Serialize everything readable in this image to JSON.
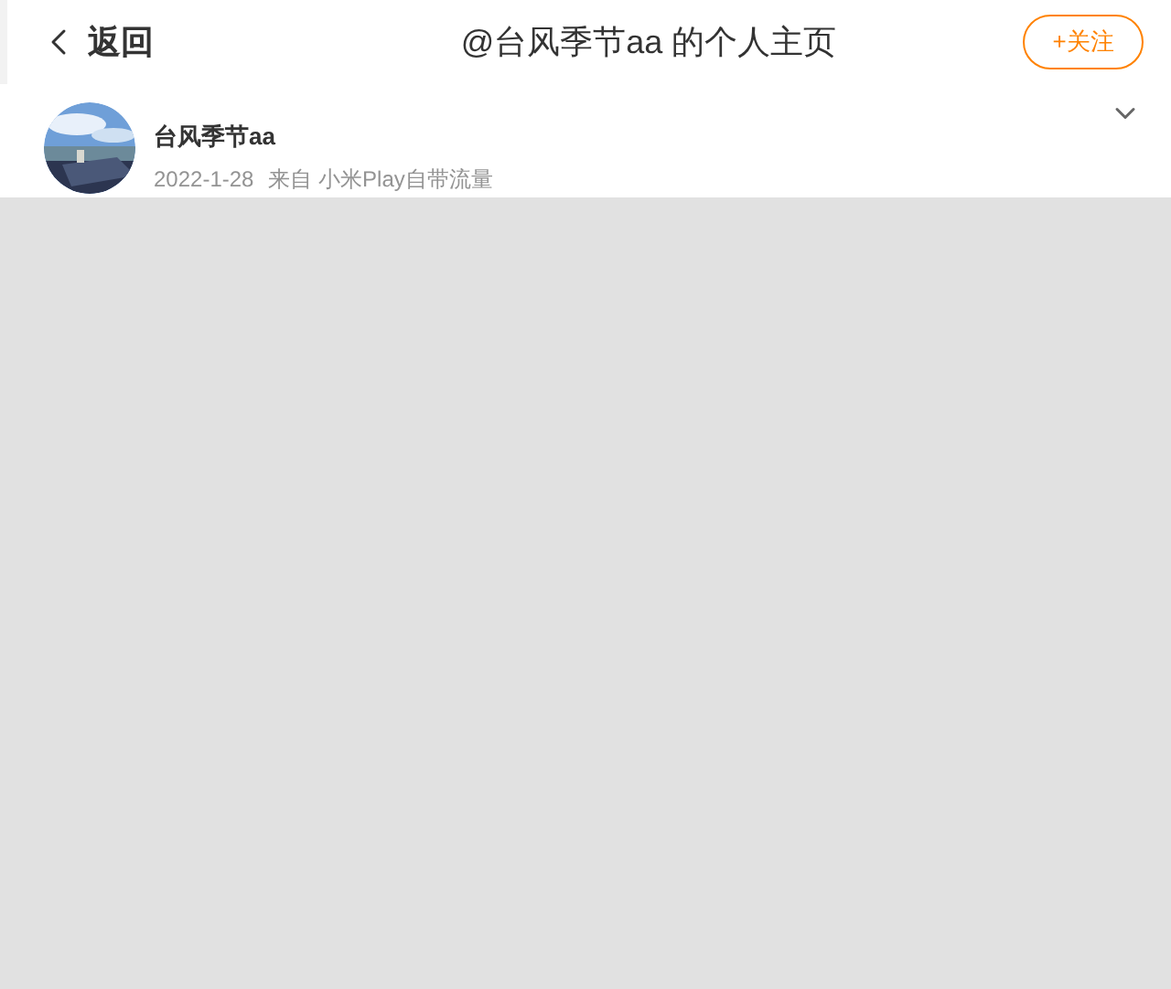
{
  "header": {
    "back_label": "返回",
    "title": "@台风季节aa 的个人主页",
    "follow_button": "+关注"
  },
  "post": {
    "author": "台风季节aa",
    "date": "2022-1-28",
    "source": "来自 小米Play自带流量"
  }
}
